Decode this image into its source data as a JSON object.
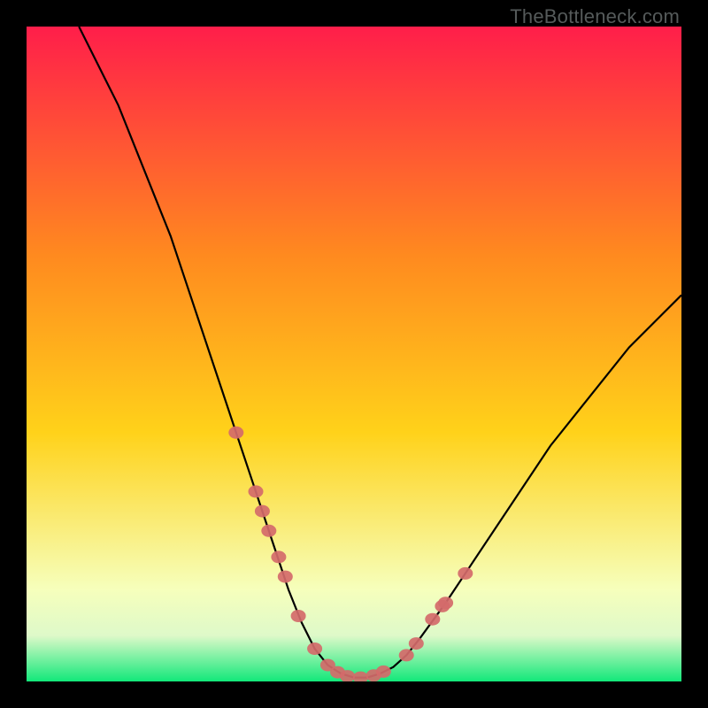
{
  "watermark": "TheBottleneck.com",
  "palette": {
    "gradient_top": "#ff1e4a",
    "gradient_mid": "#ffd21a",
    "gradient_low": "#f6ffbc",
    "gradient_bottom": "#12e87a",
    "curve": "#000000",
    "marker_fill": "#d46a6a",
    "marker_stroke": "#a94a4a"
  },
  "chart_data": {
    "type": "line",
    "title": "",
    "xlabel": "",
    "ylabel": "",
    "xlim": [
      0,
      100
    ],
    "ylim": [
      0,
      100
    ],
    "curve": {
      "x": [
        8,
        10,
        12,
        14,
        16,
        18,
        20,
        22,
        24,
        26,
        28,
        30,
        32,
        34,
        36,
        38,
        40,
        42,
        44,
        46,
        48,
        50,
        52,
        54,
        56,
        58,
        60,
        64,
        68,
        72,
        76,
        80,
        84,
        88,
        92,
        96,
        100
      ],
      "y": [
        100,
        96,
        92,
        88,
        83,
        78,
        73,
        68,
        62,
        56,
        50,
        44,
        38,
        32,
        26,
        20,
        14,
        9,
        5,
        2.5,
        1.2,
        0.6,
        0.6,
        1.2,
        2.2,
        4,
        6.5,
        12,
        18,
        24,
        30,
        36,
        41,
        46,
        51,
        55,
        59
      ]
    },
    "markers": [
      {
        "x": 32,
        "y": 38
      },
      {
        "x": 35,
        "y": 29
      },
      {
        "x": 36,
        "y": 26
      },
      {
        "x": 37,
        "y": 23
      },
      {
        "x": 38.5,
        "y": 19
      },
      {
        "x": 39.5,
        "y": 16
      },
      {
        "x": 41.5,
        "y": 10
      },
      {
        "x": 44,
        "y": 5
      },
      {
        "x": 46,
        "y": 2.5
      },
      {
        "x": 47.5,
        "y": 1.4
      },
      {
        "x": 49,
        "y": 0.8
      },
      {
        "x": 51,
        "y": 0.6
      },
      {
        "x": 53,
        "y": 0.9
      },
      {
        "x": 54.5,
        "y": 1.5
      },
      {
        "x": 58,
        "y": 4
      },
      {
        "x": 59.5,
        "y": 5.8
      },
      {
        "x": 62,
        "y": 9.5
      },
      {
        "x": 63.5,
        "y": 11.5
      },
      {
        "x": 64,
        "y": 12
      },
      {
        "x": 67,
        "y": 16.5
      }
    ]
  }
}
